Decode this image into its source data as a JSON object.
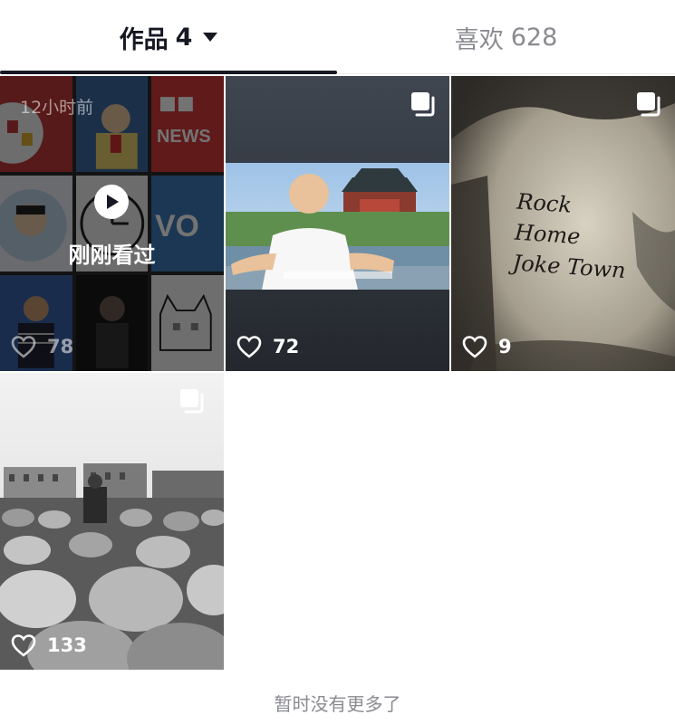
{
  "tabs": {
    "works_label": "作品",
    "works_count": "4",
    "likes_label": "喜欢",
    "likes_count": "628"
  },
  "posts": [
    {
      "likes": "78",
      "time_ago": "12小时前",
      "overlay_label": "刚刚看过",
      "multi_image": false
    },
    {
      "likes": "72",
      "multi_image": true
    },
    {
      "likes": "9",
      "multi_image": true,
      "wall_text": "Rock Home Joke Town"
    },
    {
      "likes": "133",
      "multi_image": true
    }
  ],
  "footer": {
    "text": "暂时没有更多了"
  },
  "icons": {
    "heart": "heart-outline-icon",
    "multi": "multi-image-icon",
    "play": "play-icon",
    "caret": "caret-down-icon"
  },
  "colors": {
    "primary_text": "#161823",
    "secondary_text": "#8a8b91",
    "background": "#ffffff"
  }
}
